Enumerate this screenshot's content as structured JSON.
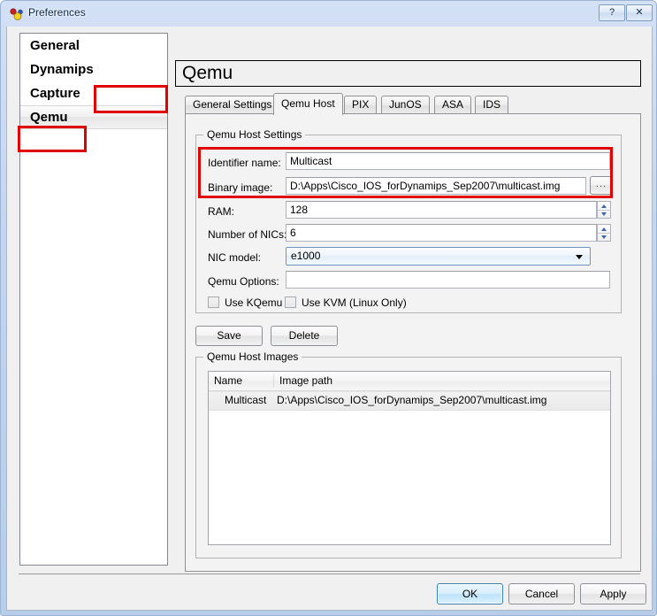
{
  "window": {
    "title": "Preferences",
    "icon": "gns3-dots-icon",
    "help_label": "?",
    "close_label": "✕"
  },
  "sidebar": {
    "items": [
      {
        "label": "General",
        "selected": false
      },
      {
        "label": "Dynamips",
        "selected": false
      },
      {
        "label": "Capture",
        "selected": false
      },
      {
        "label": "Qemu",
        "selected": true
      }
    ]
  },
  "page": {
    "title": "Qemu"
  },
  "tabs": [
    {
      "label": "General Settings",
      "active": false
    },
    {
      "label": "Qemu Host",
      "active": true
    },
    {
      "label": "PIX",
      "active": false
    },
    {
      "label": "JunOS",
      "active": false
    },
    {
      "label": "ASA",
      "active": false
    },
    {
      "label": "IDS",
      "active": false
    }
  ],
  "settings_group": {
    "title": "Qemu Host Settings",
    "fields": {
      "identifier_name": {
        "label": "Identifier name:",
        "value": "Multicast",
        "placeholder": ""
      },
      "binary_image": {
        "label": "Binary image:",
        "value": "D:\\Apps\\Cisco_IOS_forDynamips_Sep2007\\multicast.img",
        "placeholder": ""
      },
      "browse_label": "...",
      "ram": {
        "label": "RAM:",
        "value": "128"
      },
      "number_of_nics": {
        "label": "Number of NICs:",
        "value": "6"
      },
      "nic_model": {
        "label": "NIC model:",
        "value": "e1000"
      },
      "qemu_options": {
        "label": "Qemu Options:",
        "value": "",
        "placeholder": ""
      }
    },
    "checkboxes": [
      {
        "label": "Use KQemu",
        "checked": false
      },
      {
        "label": "Use KVM (Linux Only)",
        "checked": false
      }
    ]
  },
  "actions": {
    "save_label": "Save",
    "delete_label": "Delete"
  },
  "images_group": {
    "title": "Qemu Host Images",
    "columns": [
      "Name",
      "Image path"
    ],
    "rows": [
      {
        "name": "Multicast",
        "image_path": "D:\\Apps\\Cisco_IOS_forDynamips_Sep2007\\multicast.img",
        "selected": true
      }
    ]
  },
  "dialog_buttons": {
    "ok_label": "OK",
    "cancel_label": "Cancel",
    "apply_label": "Apply"
  },
  "colors": {
    "highlight_red": "#e00000",
    "accent_blue": "#3c7fb1",
    "titlebar_blue": "#b8cdea"
  }
}
